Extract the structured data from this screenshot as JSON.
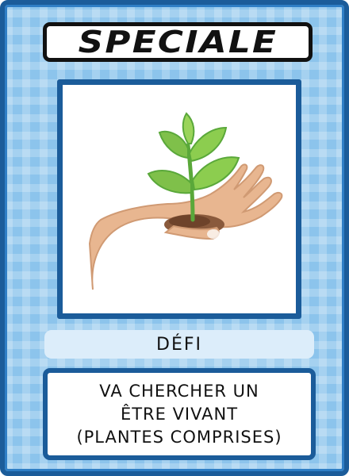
{
  "card": {
    "title": "SPECIALE",
    "image_icon": "hand-holding-plant-icon",
    "label": "DÉFI",
    "description_lines": [
      "VA CHERCHER UN",
      "ÊTRE VIVANT",
      "(PLANTES COMPRISES)"
    ]
  },
  "colors": {
    "border": "#1b5c9a",
    "background": "#8cc4ec",
    "label_bar": "#dcedfa"
  }
}
